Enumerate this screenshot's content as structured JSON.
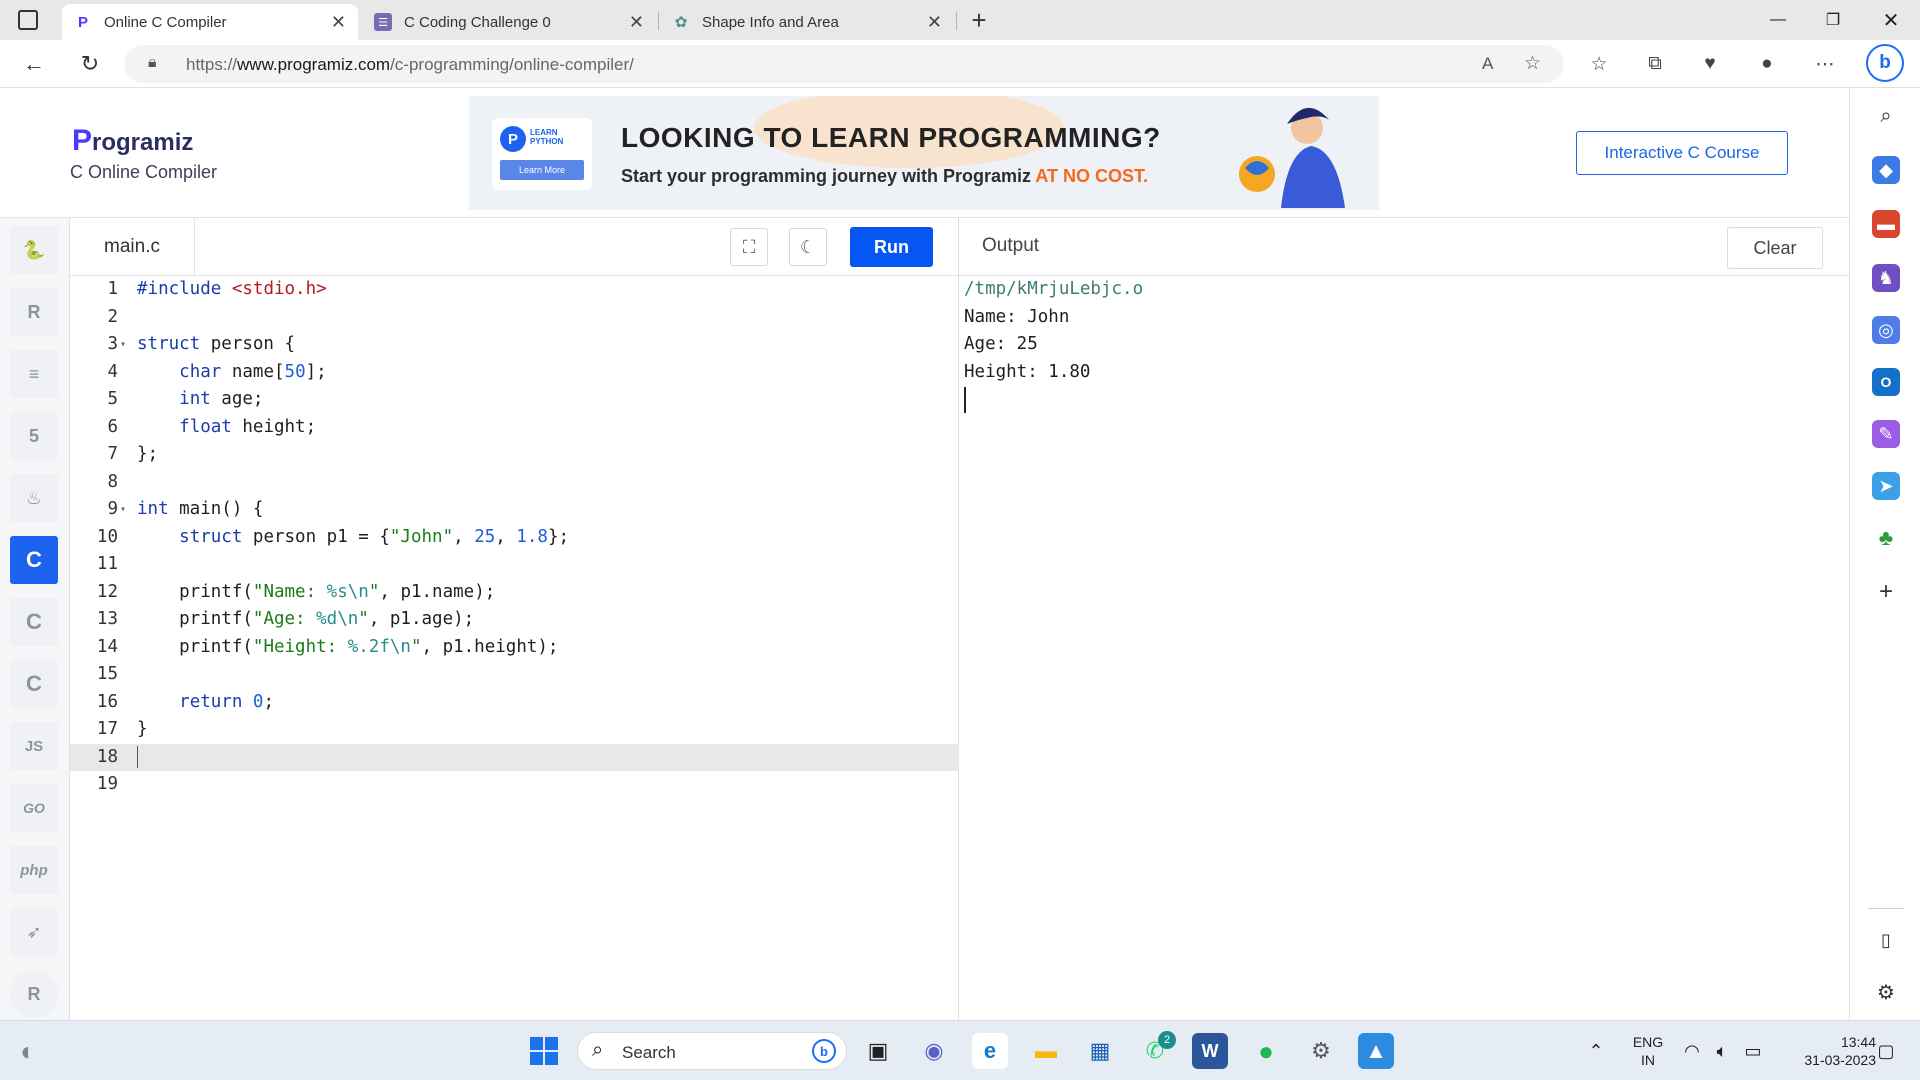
{
  "browser": {
    "tabs": [
      {
        "title": "Online C Compiler",
        "active": true
      },
      {
        "title": "C Coding Challenge 0",
        "active": false
      },
      {
        "title": "Shape Info and Area",
        "active": false
      }
    ],
    "url_prefix": "https://",
    "url_domain": "www.programiz.com",
    "url_path": "/c-programming/online-compiler/"
  },
  "page": {
    "logo_text": "rogramiz",
    "logo_initial": "P",
    "subtitle": "C Online Compiler",
    "course_button": "Interactive C Course",
    "banner": {
      "card_tag_1": "LEARN",
      "card_tag_2": "PYTHON",
      "card_button": "Learn More",
      "headline": "LOOKING TO LEARN PROGRAMMING?",
      "subline": "Start your programming journey with Programiz ",
      "subline_highlight": "AT NO COST."
    }
  },
  "languages": [
    {
      "name": "python",
      "glyph": "🐍"
    },
    {
      "name": "r",
      "glyph": "R"
    },
    {
      "name": "sql",
      "glyph": "≡"
    },
    {
      "name": "html",
      "glyph": "5"
    },
    {
      "name": "java",
      "glyph": "♨"
    },
    {
      "name": "c",
      "glyph": "C"
    },
    {
      "name": "cpp",
      "glyph": "C"
    },
    {
      "name": "csharp",
      "glyph": "C"
    },
    {
      "name": "js",
      "glyph": "JS"
    },
    {
      "name": "go",
      "glyph": "GO"
    },
    {
      "name": "php",
      "glyph": "php"
    },
    {
      "name": "swift",
      "glyph": "➶"
    },
    {
      "name": "rust",
      "glyph": "R"
    }
  ],
  "editor": {
    "filename": "main.c",
    "run_label": "Run",
    "lines": [
      "1",
      "2",
      "3",
      "4",
      "5",
      "6",
      "7",
      "8",
      "9",
      "10",
      "11",
      "12",
      "13",
      "14",
      "15",
      "16",
      "17",
      "18",
      "19"
    ]
  },
  "output": {
    "title": "Output",
    "clear_label": "Clear",
    "lines": [
      "/tmp/kMrjuLebjc.o",
      "Name: John",
      "Age: 25",
      "Height: 1.80"
    ]
  },
  "taskbar": {
    "search_label": "Search",
    "lang_1": "ENG",
    "lang_2": "IN",
    "time": "13:44",
    "date": "31-03-2023",
    "whatsapp_badge": "2"
  }
}
